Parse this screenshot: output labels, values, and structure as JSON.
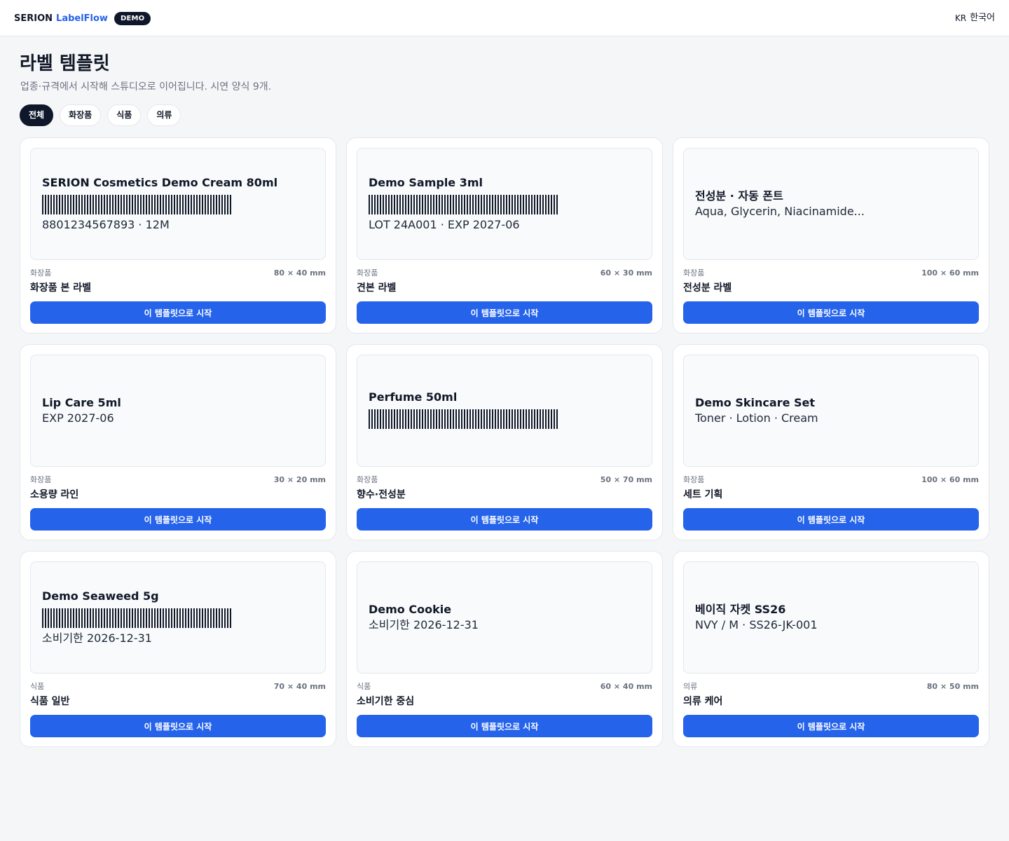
{
  "header": {
    "brand_name": "SERION",
    "brand_product": "LabelFlow",
    "badge": "DEMO",
    "lang_code": "KR",
    "lang_label": "한국어"
  },
  "page": {
    "title": "라벨 템플릿",
    "subtitle": "업종·규격에서 시작해 스튜디오로 이어집니다. 시연 양식 9개."
  },
  "filters": [
    {
      "label": "전체",
      "active": true
    },
    {
      "label": "화장품",
      "active": false
    },
    {
      "label": "식품",
      "active": false
    },
    {
      "label": "의류",
      "active": false
    }
  ],
  "templates": [
    {
      "preview_title": "SERION Cosmetics Demo Cream 80ml",
      "barcode": true,
      "preview_sub": "8801234567893 · 12M",
      "category": "화장품",
      "size": "80 × 40 mm",
      "name": "화장품 본 라벨",
      "button": "이 템플릿으로 시작"
    },
    {
      "preview_title": "Demo Sample 3ml",
      "barcode": true,
      "preview_sub": "LOT 24A001 · EXP 2027-06",
      "category": "화장품",
      "size": "60 × 30 mm",
      "name": "견본 라벨",
      "button": "이 템플릿으로 시작"
    },
    {
      "preview_title": "전성분 · 자동 폰트",
      "barcode": false,
      "preview_sub": "Aqua, Glycerin, Niacinamide...",
      "category": "화장품",
      "size": "100 × 60 mm",
      "name": "전성분 라벨",
      "button": "이 템플릿으로 시작"
    },
    {
      "preview_title": "Lip Care 5ml",
      "barcode": false,
      "preview_sub": "EXP 2027-06",
      "category": "화장품",
      "size": "30 × 20 mm",
      "name": "소용량 라인",
      "button": "이 템플릿으로 시작"
    },
    {
      "preview_title": "Perfume 50ml",
      "barcode": true,
      "preview_sub": "",
      "category": "화장품",
      "size": "50 × 70 mm",
      "name": "향수·전성분",
      "button": "이 템플릿으로 시작"
    },
    {
      "preview_title": "Demo Skincare Set",
      "barcode": false,
      "preview_sub": "Toner · Lotion · Cream",
      "category": "화장품",
      "size": "100 × 60 mm",
      "name": "세트 기획",
      "button": "이 템플릿으로 시작"
    },
    {
      "preview_title": "Demo Seaweed 5g",
      "barcode": true,
      "preview_sub": "소비기한 2026-12-31",
      "category": "식품",
      "size": "70 × 40 mm",
      "name": "식품 일반",
      "button": "이 템플릿으로 시작"
    },
    {
      "preview_title": "Demo Cookie",
      "barcode": false,
      "preview_sub": "소비기한 2026-12-31",
      "category": "식품",
      "size": "60 × 40 mm",
      "name": "소비기한 중심",
      "button": "이 템플릿으로 시작"
    },
    {
      "preview_title": "베이직 자켓 SS26",
      "barcode": false,
      "preview_sub": "NVY / M · SS26-JK-001",
      "category": "의류",
      "size": "80 × 50 mm",
      "name": "의류 케어",
      "button": "이 템플릿으로 시작"
    }
  ]
}
